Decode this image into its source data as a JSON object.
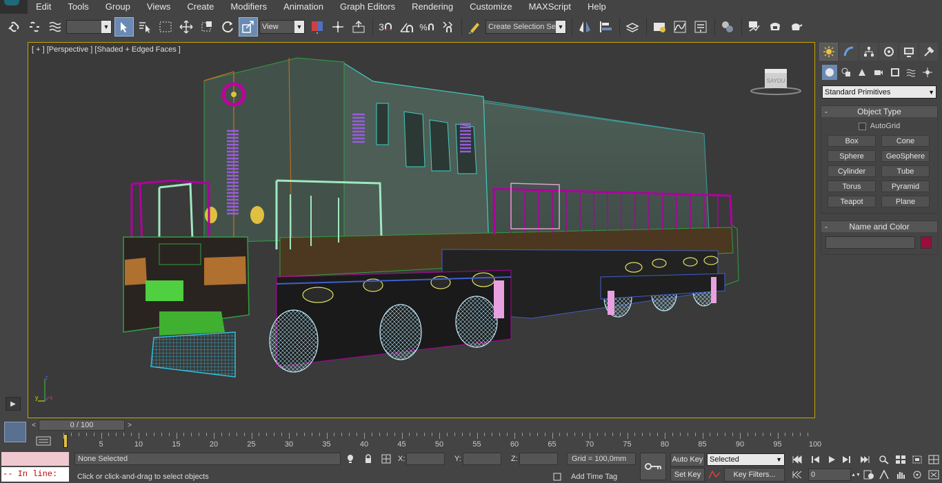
{
  "menu": [
    "Edit",
    "Tools",
    "Group",
    "Views",
    "Create",
    "Modifiers",
    "Animation",
    "Graph Editors",
    "Rendering",
    "Customize",
    "MAXScript",
    "Help"
  ],
  "toolbar": {
    "view_dropdown": "View",
    "selection_set_placeholder": "Create Selection Se",
    "snaps_label": "3",
    "percent_snap": "%"
  },
  "viewport": {
    "label": "[ + ] [Perspective ] [Shaded + Edged Faces ]",
    "viewcube_text": "SAYDU",
    "axis_x": "x",
    "axis_y": "y",
    "axis_z": "z"
  },
  "command_panel": {
    "category": "Standard Primitives",
    "object_type_title": "Object Type",
    "autogrid_label": "AutoGrid",
    "primitives": [
      "Box",
      "Cone",
      "Sphere",
      "GeoSphere",
      "Cylinder",
      "Tube",
      "Torus",
      "Pyramid",
      "Teapot",
      "Plane"
    ],
    "name_color_title": "Name and Color",
    "object_color": "#9c0c3c",
    "minus": "-"
  },
  "timeline": {
    "frame_display": "0 / 100",
    "prev": "<",
    "next": ">",
    "ticks": [
      "5",
      "10",
      "15",
      "20",
      "25",
      "30",
      "35",
      "40",
      "45",
      "50",
      "55",
      "60",
      "65",
      "70",
      "75",
      "80",
      "85",
      "90",
      "95",
      "100"
    ]
  },
  "status": {
    "maxscript_inline": "-- In line:",
    "selection": "None Selected",
    "prompt": "Click or click-and-drag to select objects",
    "x_label": "X:",
    "y_label": "Y:",
    "z_label": "Z:",
    "grid": "Grid = 100,0mm",
    "add_time_tag": "Add Time Tag",
    "auto_key": "Auto Key",
    "set_key": "Set Key",
    "key_mode": "Selected",
    "key_filters": "Key Filters...",
    "current_frame": "0"
  },
  "colors": {
    "viewport_border": "#c8a400",
    "background": "#444444",
    "viewport_bg": "#3a3a3a",
    "active_tool": "#6a8ab4"
  }
}
